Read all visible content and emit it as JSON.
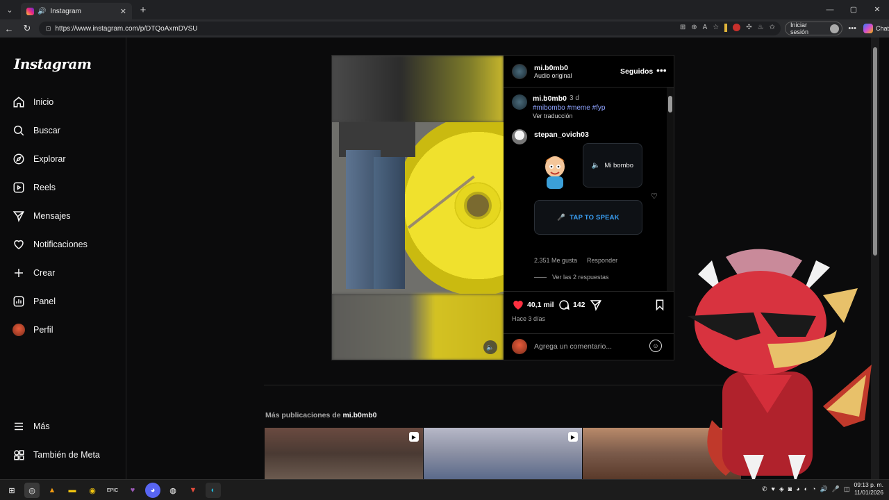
{
  "browser": {
    "tab_title": "Instagram",
    "tab_close": "✕",
    "new_tab": "+",
    "url": "https://www.instagram.com/p/DTQoAxmDVSU",
    "signin_label": "Iniciar sesión",
    "chat_label": "Chat",
    "window_controls": [
      "—",
      "▢",
      "✕"
    ]
  },
  "sidebar": {
    "logo": "Instagram",
    "items": [
      {
        "label": "Inicio",
        "icon": "home-icon"
      },
      {
        "label": "Buscar",
        "icon": "search-icon"
      },
      {
        "label": "Explorar",
        "icon": "compass-icon"
      },
      {
        "label": "Reels",
        "icon": "reels-icon"
      },
      {
        "label": "Mensajes",
        "icon": "send-icon"
      },
      {
        "label": "Notificaciones",
        "icon": "heart-icon"
      },
      {
        "label": "Crear",
        "icon": "plus-icon"
      },
      {
        "label": "Panel",
        "icon": "chart-icon"
      },
      {
        "label": "Perfil",
        "icon": "avatar"
      }
    ],
    "more": "Más",
    "meta": "También de Meta"
  },
  "post": {
    "author": "mi.b0mb0",
    "audio": "Audio original",
    "follow_state": "Seguidos",
    "menu": "•••",
    "caption": {
      "user": "mi.b0mb0",
      "time": "3 d",
      "tags": "#mibombo #meme #fyp",
      "translate": "Ver traducción"
    },
    "comment": {
      "user": "stepan_ovich03",
      "sticker_text": "Mi bombo",
      "tap_label": "TAP TO SPEAK",
      "likes": "2.351 Me gusta",
      "reply": "Responder",
      "view_replies": "Ver las 2 respuestas"
    },
    "likes_count": "40,1 mil",
    "comments_count": "142",
    "posted": "Hace 3 días",
    "comment_placeholder": "Agrega un comentario..."
  },
  "more_posts": {
    "prefix": "Más publicaciones de",
    "user": "mi.b0mb0"
  },
  "taskbar": {
    "time": "09:13 p. m.",
    "date": "11/01/2026"
  },
  "colors": {
    "accent_blue": "#3aa0f5",
    "hashtag": "#8ea3ff",
    "heart": "#ff3040",
    "wheel_yellow": "#e6d71f"
  }
}
